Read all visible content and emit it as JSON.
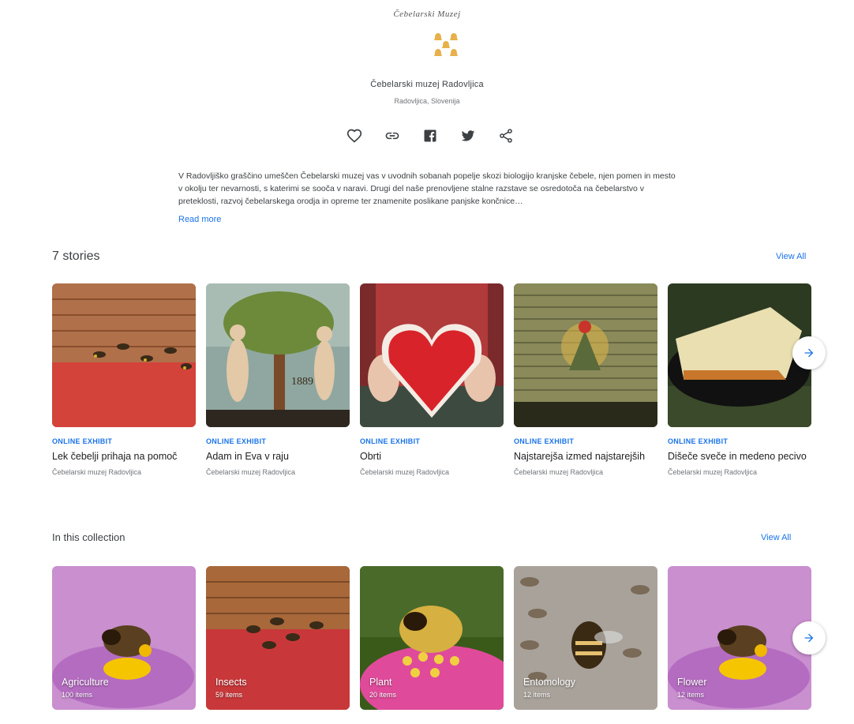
{
  "logo": {
    "text": "Čebelarski Muzej"
  },
  "institution": {
    "name": "Čebelarski muzej Radovljica",
    "location": "Radovljica, Slovenija"
  },
  "actions": {
    "icons": [
      "heart-icon",
      "link-icon",
      "facebook-icon",
      "twitter-icon",
      "share-icon"
    ]
  },
  "description": {
    "text": "V Radovljiško graščino umeščen Čebelarski muzej vas v uvodnih sobanah popelje skozi biologijo kranjske čebele, njen pomen in mesto v okolju ter nevarnosti, s katerimi se sooča v naravi. Drugi del naše prenovljene stalne razstave se osredotoča na čebelarstvo v preteklosti, razvoj čebelarskega orodja in opreme ter znamenite poslikane panjske končnice…",
    "read_more": "Read more"
  },
  "stories": {
    "title": "7 stories",
    "view_all": "View All",
    "items": [
      {
        "badge": "ONLINE EXHIBIT",
        "title": "Lek čebelji prihaja na pomoč",
        "owner": "Čebelarski muzej Radovljica"
      },
      {
        "badge": "ONLINE EXHIBIT",
        "title": "Adam in Eva v raju",
        "owner": "Čebelarski muzej Radovljica"
      },
      {
        "badge": "ONLINE EXHIBIT",
        "title": "Obrti",
        "owner": "Čebelarski muzej Radovljica"
      },
      {
        "badge": "ONLINE EXHIBIT",
        "title": "Najstarejša izmed najstarejših",
        "owner": "Čebelarski muzej Radovljica"
      },
      {
        "badge": "ONLINE EXHIBIT",
        "title": "Dišeče sveče in medeno pecivo",
        "owner": "Čebelarski muzej Radovljica"
      }
    ]
  },
  "collection": {
    "title": "In this collection",
    "view_all": "View All",
    "items": [
      {
        "label": "Agriculture",
        "count": "100 items"
      },
      {
        "label": "Insects",
        "count": "59 items"
      },
      {
        "label": "Plant",
        "count": "20 items"
      },
      {
        "label": "Entomology",
        "count": "12 items"
      },
      {
        "label": "Flower",
        "count": "12 items"
      }
    ]
  },
  "colors": {
    "accent": "#1a73e8",
    "text": "#202124",
    "muted": "#70757a"
  }
}
